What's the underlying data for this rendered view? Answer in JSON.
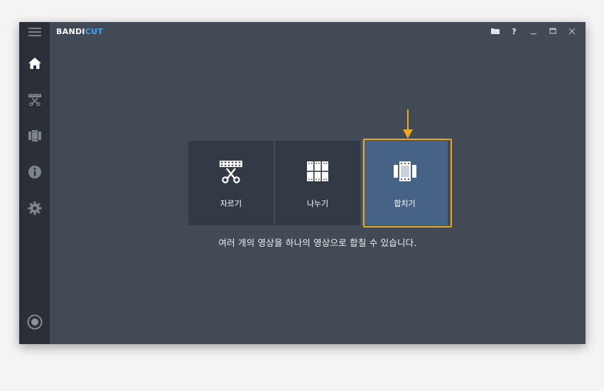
{
  "app": {
    "logo_main": "BANDI",
    "logo_accent": "CUT",
    "accent_color": "#3aa8f0"
  },
  "sidebar": {
    "items": [
      {
        "name": "menu",
        "icon": "hamburger-menu-icon"
      },
      {
        "name": "home",
        "icon": "home-icon"
      },
      {
        "name": "cut",
        "icon": "film-scissors-icon"
      },
      {
        "name": "join",
        "icon": "film-join-icon"
      },
      {
        "name": "info",
        "icon": "info-icon"
      },
      {
        "name": "settings",
        "icon": "gear-icon"
      },
      {
        "name": "record",
        "icon": "record-icon"
      }
    ]
  },
  "window_controls": {
    "folder": "folder-icon",
    "help_label": "?",
    "minimize": "minimize-icon",
    "maximize": "maximize-icon",
    "close": "close-icon"
  },
  "modes": [
    {
      "label": "자르기",
      "icon": "cut-icon",
      "active": false
    },
    {
      "label": "나누기",
      "icon": "split-icon",
      "active": false
    },
    {
      "label": "합치기",
      "icon": "join-icon",
      "active": true
    }
  ],
  "description": "여러 개의 영상을 하나의 영상으로 합칠 수 있습니다.",
  "colors": {
    "highlight": "#f0a81b",
    "active_tile": "#466386",
    "tile": "#323a45",
    "background": "#414a55",
    "sidebar": "#2b3038"
  }
}
